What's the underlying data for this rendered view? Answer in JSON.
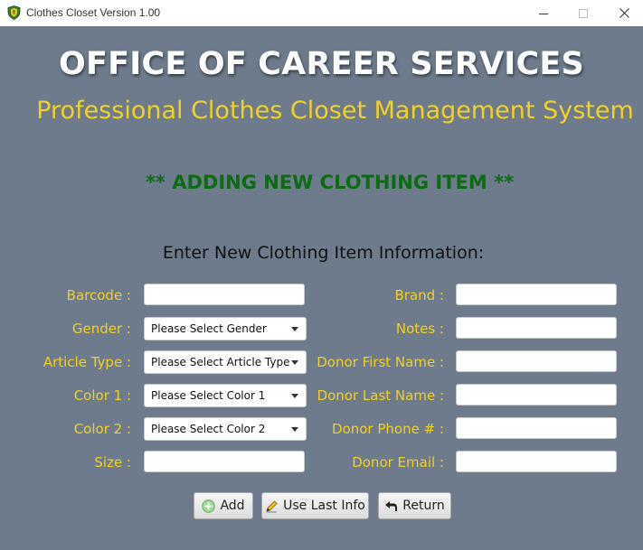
{
  "window": {
    "title": "Clothes Closet Version 1.00"
  },
  "header": {
    "office": "OFFICE OF CAREER SERVICES",
    "system": "Professional Clothes Closet Management System",
    "mode": "** ADDING NEW CLOTHING ITEM **",
    "instruction": "Enter New Clothing Item Information:"
  },
  "form": {
    "left": {
      "barcode_label": "Barcode :",
      "gender_label": "Gender :",
      "gender_value": "Please Select Gender",
      "article_label": "Article Type :",
      "article_value": "Please Select Article Type",
      "color1_label": "Color 1 :",
      "color1_value": "Please Select Color 1",
      "color2_label": "Color 2 :",
      "color2_value": "Please Select Color 2",
      "size_label": "Size :"
    },
    "right": {
      "brand_label": "Brand :",
      "notes_label": "Notes :",
      "donor_first_label": "Donor First Name :",
      "donor_last_label": "Donor Last Name :",
      "donor_phone_label": "Donor Phone # :",
      "donor_email_label": "Donor Email :"
    }
  },
  "buttons": {
    "add": "Add",
    "use_last": "Use Last Info",
    "return": "Return"
  },
  "icons": {
    "app": "shield-crest-icon",
    "add": "plus-circle-icon",
    "use_last": "pencil-icon",
    "return": "return-arrow-icon"
  },
  "colors": {
    "background": "#6d7b8d",
    "label": "#f2d024",
    "mode_heading": "#0d6b12"
  }
}
